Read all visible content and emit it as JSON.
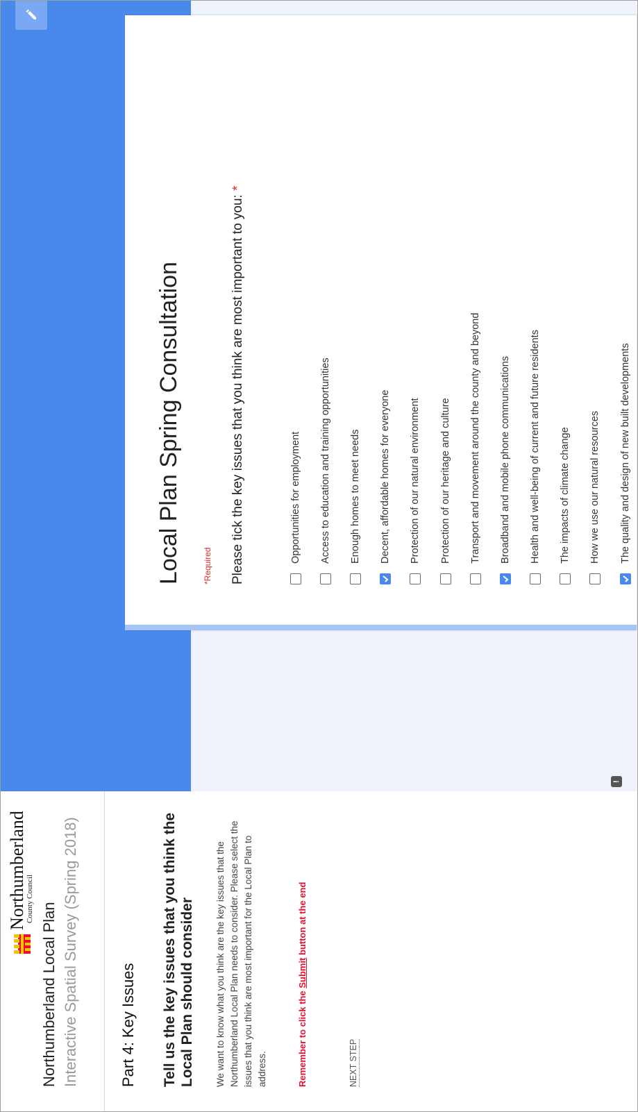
{
  "header": {
    "logo_name": "Northumberland",
    "logo_sub": "County Council",
    "app_title": "Northumberland Local Plan",
    "app_subtitle": "Interactive Spatial Survey (Spring 2018)"
  },
  "sidebar": {
    "part_title": "Part 4: Key Issues",
    "heading": "Tell us the key issues that you think the Local Plan should consider",
    "body": "We want to know what you think are the key issues that the Northumberland Local Plan needs to consider. Please select the issues that you think are most important for the Local Plan to address.",
    "submit_note_prefix": "Remember to click the ",
    "submit_note_link": "Submit",
    "submit_note_suffix": " button at the end",
    "next_step": "NEXT STEP"
  },
  "form": {
    "title": "Local Plan Spring Consultation",
    "required_note": "*Required",
    "question": "Please tick the key issues that you think are most important to you:",
    "required_star": "*",
    "help_badge": "!",
    "options": [
      {
        "label": "Opportunities for employment",
        "checked": false
      },
      {
        "label": "Access to education and training opportunities",
        "checked": false
      },
      {
        "label": "Enough homes to meet needs",
        "checked": false
      },
      {
        "label": "Decent, affordable homes for everyone",
        "checked": true
      },
      {
        "label": "Protection of our natural environment",
        "checked": false
      },
      {
        "label": "Protection of our heritage and culture",
        "checked": false
      },
      {
        "label": "Transport and movement around the county and beyond",
        "checked": false
      },
      {
        "label": "Broadband and mobile phone communications",
        "checked": true
      },
      {
        "label": "Health and well-being of current and future residents",
        "checked": false
      },
      {
        "label": "The impacts of climate change",
        "checked": false
      },
      {
        "label": "How we use our natural resources",
        "checked": false
      },
      {
        "label": "The quality and design of new built developments",
        "checked": true
      }
    ]
  },
  "colors": {
    "accent": "#4a89ec",
    "required": "#d93025",
    "submit_note": "#e8112d"
  }
}
